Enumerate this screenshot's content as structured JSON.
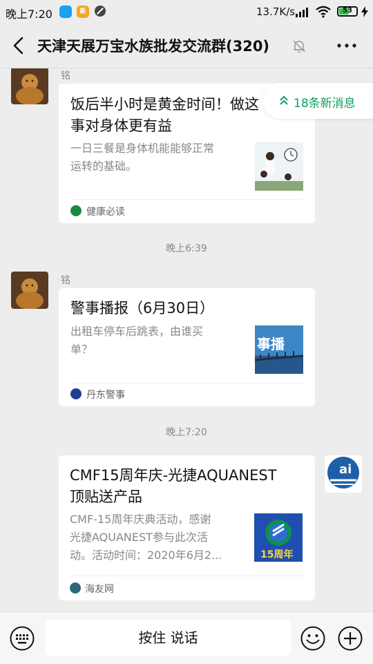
{
  "status_bar": {
    "time": "晚上7:20",
    "net_speed": "13.7K/s",
    "battery_level": "53",
    "icons": [
      "chat-app-icon",
      "news-app-icon",
      "blocked-icon",
      "signal-icon",
      "wifi-icon",
      "battery-icon",
      "charging-icon"
    ]
  },
  "header": {
    "back_icon": "back-chevron-icon",
    "title": "天津天展万宝水族批发交流群(320)",
    "mute_icon": "bell-off-icon",
    "more_icon": "more-dots-icon"
  },
  "new_messages_pill": {
    "label": "18条新消息",
    "color": "#07a35a",
    "icon": "double-chevron-up-icon"
  },
  "messages": [
    {
      "sender": "铭",
      "title_line1": "饭后半小时是黄金时间！做这",
      "title_line2": "事对身体更有益",
      "desc_line1": "一日三餐是身体机能能够正常",
      "desc_line2": "运转的基础。",
      "source": "健康必读",
      "source_icon_color": "#1a8a3e"
    },
    {
      "time": "晚上6:39",
      "sender": "铭",
      "title_line1": "警事播报（6月30日）",
      "desc_line1": "出租车停车后跳表，由谁买",
      "desc_line2": "单？",
      "thumb_text": "事播",
      "source": "丹东警事",
      "source_icon_color": "#1f3f8f"
    },
    {
      "time": "晚上7:20",
      "title_line1": "CMF15周年庆-光捷AQUANEST",
      "title_line2": "顶贴送产品",
      "desc_line1": "CMF-15周年庆典活动，感谢",
      "desc_line2": "光捷AQUANEST参与此次活",
      "desc_line3": "动。活动时间：2020年6月2...",
      "thumb_text": "15周年",
      "source": "海友网",
      "source_icon_color": "#2b6a7a"
    }
  ],
  "input_bar": {
    "hold_to_talk": "按住 说话",
    "left_icon": "keyboard-icon",
    "emoji_icon": "emoji-icon",
    "plus_icon": "plus-circle-icon"
  }
}
